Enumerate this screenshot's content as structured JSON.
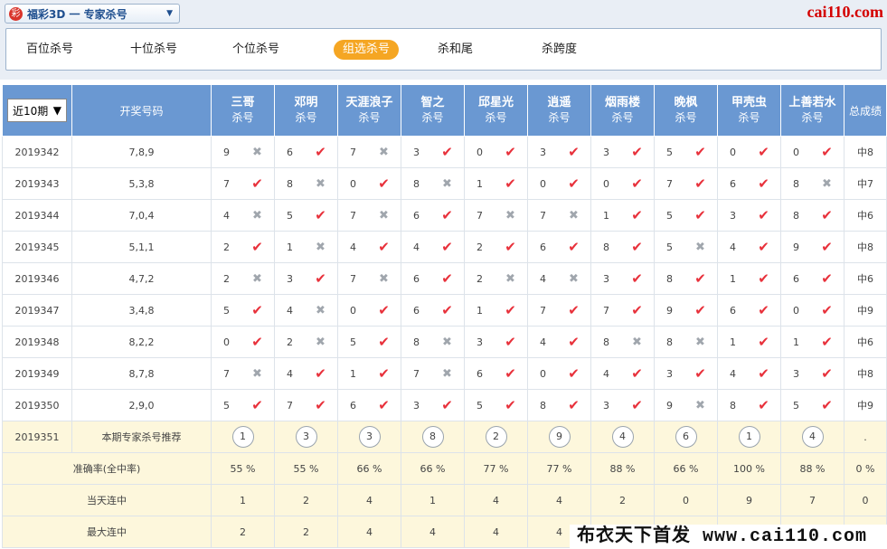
{
  "header": {
    "logo_glyph": "彩",
    "lottery_select": "福彩3D 一 专家杀号",
    "brand": "cai110.com"
  },
  "tabs": [
    {
      "label": "百位杀号",
      "active": false
    },
    {
      "label": "十位杀号",
      "active": false
    },
    {
      "label": "个位杀号",
      "active": false
    },
    {
      "label": "组选杀号",
      "active": true
    },
    {
      "label": "杀和尾",
      "active": false
    },
    {
      "label": "杀跨度",
      "active": false
    }
  ],
  "table": {
    "period_select": "近10期",
    "number_header": "开奖号码",
    "total_header": "总成绩",
    "expert_sub": "杀号",
    "experts": [
      "三哥",
      "邓明",
      "天涯浪子",
      "智之",
      "邱星光",
      "逍遥",
      "烟雨楼",
      "晚枫",
      "甲壳虫",
      "上善若水"
    ],
    "rows": [
      {
        "issue": "2019342",
        "number": "7,8,9",
        "total": "中8",
        "cells": [
          {
            "v": "9",
            "hit": false
          },
          {
            "v": "6",
            "hit": true
          },
          {
            "v": "7",
            "hit": false
          },
          {
            "v": "3",
            "hit": true
          },
          {
            "v": "0",
            "hit": true
          },
          {
            "v": "3",
            "hit": true
          },
          {
            "v": "3",
            "hit": true
          },
          {
            "v": "5",
            "hit": true
          },
          {
            "v": "0",
            "hit": true
          },
          {
            "v": "0",
            "hit": true
          }
        ]
      },
      {
        "issue": "2019343",
        "number": "5,3,8",
        "total": "中7",
        "cells": [
          {
            "v": "7",
            "hit": true
          },
          {
            "v": "8",
            "hit": false
          },
          {
            "v": "0",
            "hit": true
          },
          {
            "v": "8",
            "hit": false
          },
          {
            "v": "1",
            "hit": true
          },
          {
            "v": "0",
            "hit": true
          },
          {
            "v": "0",
            "hit": true
          },
          {
            "v": "7",
            "hit": true
          },
          {
            "v": "6",
            "hit": true
          },
          {
            "v": "8",
            "hit": false
          }
        ]
      },
      {
        "issue": "2019344",
        "number": "7,0,4",
        "total": "中6",
        "cells": [
          {
            "v": "4",
            "hit": false
          },
          {
            "v": "5",
            "hit": true
          },
          {
            "v": "7",
            "hit": false
          },
          {
            "v": "6",
            "hit": true
          },
          {
            "v": "7",
            "hit": false
          },
          {
            "v": "7",
            "hit": false
          },
          {
            "v": "1",
            "hit": true
          },
          {
            "v": "5",
            "hit": true
          },
          {
            "v": "3",
            "hit": true
          },
          {
            "v": "8",
            "hit": true
          }
        ]
      },
      {
        "issue": "2019345",
        "number": "5,1,1",
        "total": "中8",
        "cells": [
          {
            "v": "2",
            "hit": true
          },
          {
            "v": "1",
            "hit": false
          },
          {
            "v": "4",
            "hit": true
          },
          {
            "v": "4",
            "hit": true
          },
          {
            "v": "2",
            "hit": true
          },
          {
            "v": "6",
            "hit": true
          },
          {
            "v": "8",
            "hit": true
          },
          {
            "v": "5",
            "hit": false
          },
          {
            "v": "4",
            "hit": true
          },
          {
            "v": "9",
            "hit": true
          }
        ]
      },
      {
        "issue": "2019346",
        "number": "4,7,2",
        "total": "中6",
        "cells": [
          {
            "v": "2",
            "hit": false
          },
          {
            "v": "3",
            "hit": true
          },
          {
            "v": "7",
            "hit": false
          },
          {
            "v": "6",
            "hit": true
          },
          {
            "v": "2",
            "hit": false
          },
          {
            "v": "4",
            "hit": false
          },
          {
            "v": "3",
            "hit": true
          },
          {
            "v": "8",
            "hit": true
          },
          {
            "v": "1",
            "hit": true
          },
          {
            "v": "6",
            "hit": true
          }
        ]
      },
      {
        "issue": "2019347",
        "number": "3,4,8",
        "total": "中9",
        "cells": [
          {
            "v": "5",
            "hit": true
          },
          {
            "v": "4",
            "hit": false
          },
          {
            "v": "0",
            "hit": true
          },
          {
            "v": "6",
            "hit": true
          },
          {
            "v": "1",
            "hit": true
          },
          {
            "v": "7",
            "hit": true
          },
          {
            "v": "7",
            "hit": true
          },
          {
            "v": "9",
            "hit": true
          },
          {
            "v": "6",
            "hit": true
          },
          {
            "v": "0",
            "hit": true
          }
        ]
      },
      {
        "issue": "2019348",
        "number": "8,2,2",
        "total": "中6",
        "cells": [
          {
            "v": "0",
            "hit": true
          },
          {
            "v": "2",
            "hit": false
          },
          {
            "v": "5",
            "hit": true
          },
          {
            "v": "8",
            "hit": false
          },
          {
            "v": "3",
            "hit": true
          },
          {
            "v": "4",
            "hit": true
          },
          {
            "v": "8",
            "hit": false
          },
          {
            "v": "8",
            "hit": false
          },
          {
            "v": "1",
            "hit": true
          },
          {
            "v": "1",
            "hit": true
          }
        ]
      },
      {
        "issue": "2019349",
        "number": "8,7,8",
        "total": "中8",
        "cells": [
          {
            "v": "7",
            "hit": false
          },
          {
            "v": "4",
            "hit": true
          },
          {
            "v": "1",
            "hit": true
          },
          {
            "v": "7",
            "hit": false
          },
          {
            "v": "6",
            "hit": true
          },
          {
            "v": "0",
            "hit": true
          },
          {
            "v": "4",
            "hit": true
          },
          {
            "v": "3",
            "hit": true
          },
          {
            "v": "4",
            "hit": true
          },
          {
            "v": "3",
            "hit": true
          }
        ]
      },
      {
        "issue": "2019350",
        "number": "2,9,0",
        "total": "中9",
        "cells": [
          {
            "v": "5",
            "hit": true
          },
          {
            "v": "7",
            "hit": true
          },
          {
            "v": "6",
            "hit": true
          },
          {
            "v": "3",
            "hit": true
          },
          {
            "v": "5",
            "hit": true
          },
          {
            "v": "8",
            "hit": true
          },
          {
            "v": "3",
            "hit": true
          },
          {
            "v": "9",
            "hit": false
          },
          {
            "v": "8",
            "hit": true
          },
          {
            "v": "5",
            "hit": true
          }
        ]
      }
    ],
    "recommend": {
      "issue": "2019351",
      "label": "本期专家杀号推荐",
      "values": [
        "1",
        "3",
        "3",
        "8",
        "2",
        "9",
        "4",
        "6",
        "1",
        "4"
      ],
      "total": "."
    },
    "stats": [
      {
        "label": "准确率(全中率)",
        "values": [
          "55 %",
          "55 %",
          "66 %",
          "66 %",
          "77 %",
          "77 %",
          "88 %",
          "66 %",
          "100 %",
          "88 %"
        ],
        "total": "0 %"
      },
      {
        "label": "当天连中",
        "values": [
          "1",
          "2",
          "4",
          "1",
          "4",
          "4",
          "2",
          "0",
          "9",
          "7"
        ],
        "total": "0"
      },
      {
        "label": "最大连中",
        "values": [
          "2",
          "2",
          "4",
          "4",
          "4",
          "4",
          "",
          "",
          "",
          "",
          ""
        ],
        "total": ""
      }
    ]
  },
  "watermark": "布衣天下首发 www.cai110.com",
  "colors": {
    "header_blue": "#6a98d2",
    "hit_red": "#e8313b",
    "miss_gray": "#a0a6ad",
    "active_tab": "#f5a623",
    "brand_red": "#d40000"
  }
}
